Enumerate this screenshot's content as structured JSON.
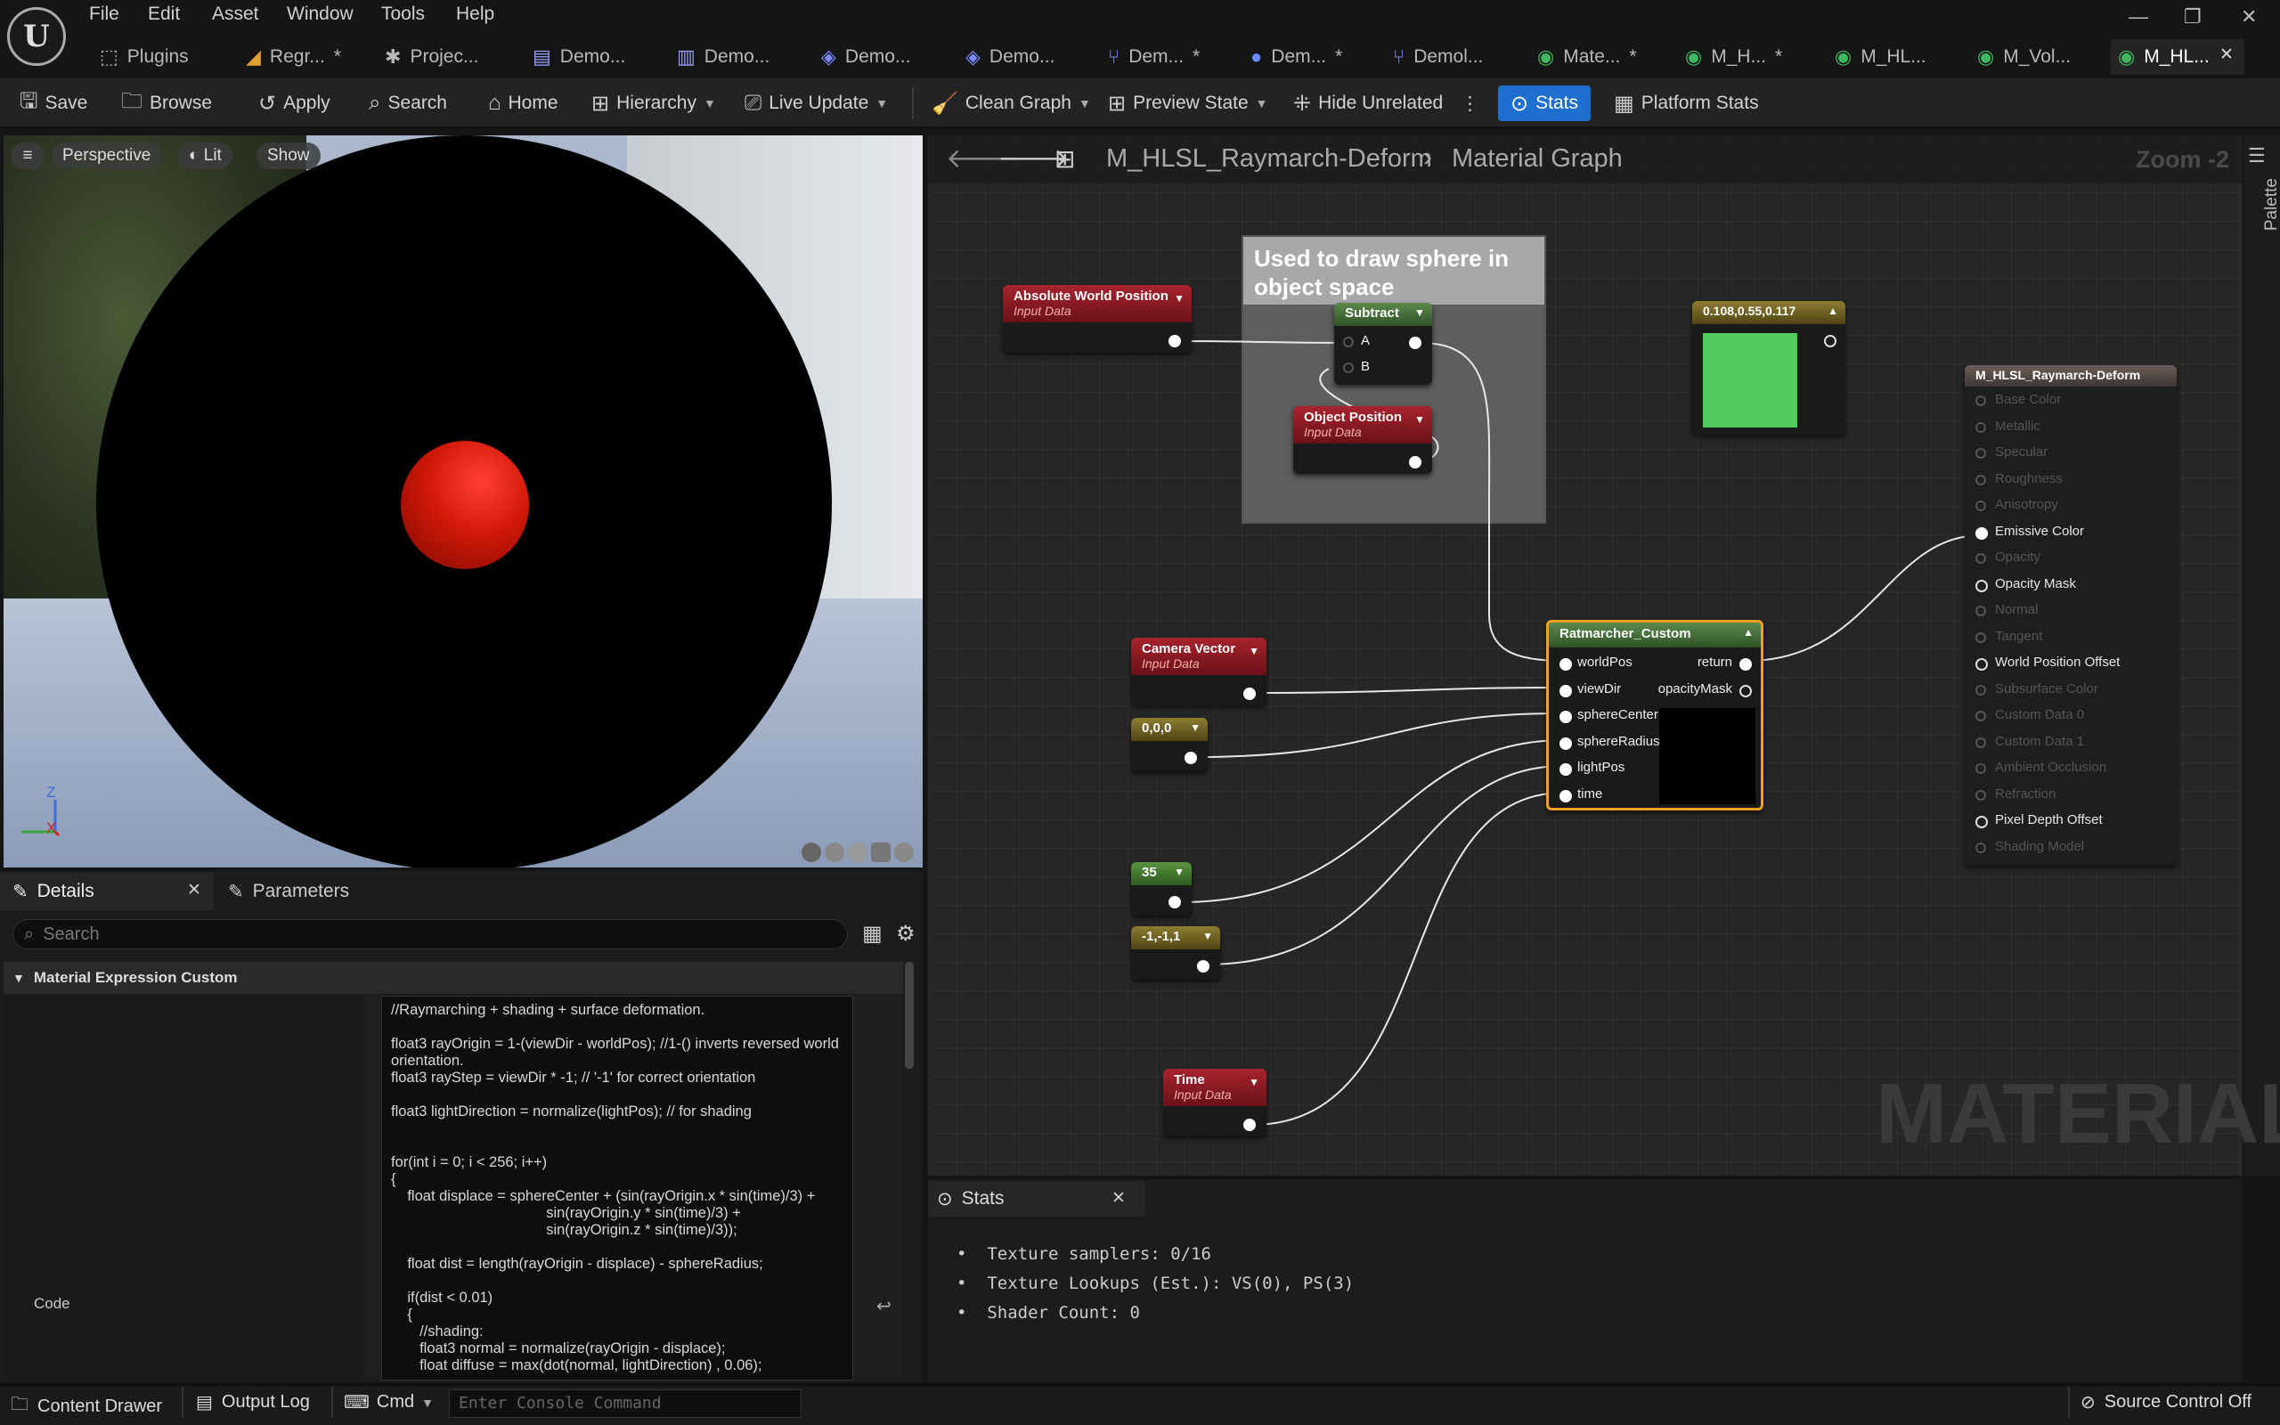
{
  "app": {
    "logo": "U"
  },
  "menu": [
    "File",
    "Edit",
    "Asset",
    "Window",
    "Tools",
    "Help"
  ],
  "tabs": [
    {
      "label": "Plugins",
      "icon": "plugin-icon"
    },
    {
      "label": "Regr...",
      "icon": "chart-icon",
      "dirty": "*"
    },
    {
      "label": "Projec...",
      "icon": "settings-icon"
    },
    {
      "label": "Demo...",
      "icon": "level-icon"
    },
    {
      "label": "Demo...",
      "icon": "blueprint-icon"
    },
    {
      "label": "Demo...",
      "icon": "cube-icon"
    },
    {
      "label": "Demo...",
      "icon": "cube-icon"
    },
    {
      "label": "Dem...",
      "icon": "graph-icon",
      "dirty": "*"
    },
    {
      "label": "Dem...",
      "icon": "material-icon",
      "dirty": "*"
    },
    {
      "label": "Demol...",
      "icon": "graph-icon"
    },
    {
      "label": "Mate...",
      "icon": "material-instance-icon",
      "dirty": "*"
    },
    {
      "label": "M_H...",
      "icon": "material-icon",
      "dirty": "*"
    },
    {
      "label": "M_HL...",
      "icon": "material-icon"
    },
    {
      "label": "M_Vol...",
      "icon": "material-icon"
    },
    {
      "label": "M_HL...",
      "icon": "material-icon",
      "close": "✕"
    }
  ],
  "toolbar": {
    "save": "Save",
    "browse": "Browse",
    "apply": "Apply",
    "search": "Search",
    "home": "Home",
    "hierarchy": "Hierarchy",
    "live_update": "Live Update",
    "clean_graph": "Clean Graph",
    "preview_state": "Preview State",
    "hide_unrelated": "Hide Unrelated",
    "stats": "Stats",
    "platform_stats": "Platform Stats"
  },
  "viewport": {
    "perspective": "Perspective",
    "lit": "Lit",
    "show": "Show",
    "axis_z": "Z",
    "axis_x": "X"
  },
  "details": {
    "tab_details": "Details",
    "tab_parameters": "Parameters",
    "search_placeholder": "Search",
    "category": "Material Expression Custom",
    "code_label": "Code",
    "code": "//Raymarching + shading + surface deformation.\n\nfloat3 rayOrigin = 1-(viewDir - worldPos); //1-() inverts reversed world\norientation.\nfloat3 rayStep = viewDir * -1; // '-1' for correct orientation\n\nfloat3 lightDirection = normalize(lightPos); // for shading\n\n\nfor(int i = 0; i < 256; i++)\n{\n    float displace = sphereCenter + (sin(rayOrigin.x * sin(time)/3) +\n                                      sin(rayOrigin.y * sin(time)/3) +\n                                      sin(rayOrigin.z * sin(time)/3));\n\n    float dist = length(rayOrigin - displace) - sphereRadius;\n\n    if(dist < 0.01)\n    {\n       //shading:\n       float3 normal = normalize(rayOrigin - displace);\n       float diffuse = max(dot(normal, lightDirection) , 0.06);"
  },
  "graph": {
    "asset": "M_HLSL_Raymarch-Deform",
    "crumb": "Material Graph",
    "zoom": "Zoom -2",
    "palette": "Palette",
    "watermark": "MATERIAL",
    "comment": "Used to draw sphere in object space",
    "nodes": {
      "awp": {
        "title": "Absolute World Position",
        "sub": "Input Data"
      },
      "subtract": {
        "title": "Subtract",
        "a": "A",
        "b": "B"
      },
      "objpos": {
        "title": "Object Position",
        "sub": "Input Data"
      },
      "color": {
        "title": "0.108,0.55,0.117",
        "swatch": "#4fcc5c"
      },
      "camvec": {
        "title": "Camera Vector",
        "sub": "Input Data"
      },
      "zero": {
        "title": "0,0,0"
      },
      "radius": {
        "title": "35"
      },
      "light": {
        "title": "-1,-1,1"
      },
      "time": {
        "title": "Time",
        "sub": "Input Data"
      },
      "custom": {
        "title": "Ratmarcher_Custom",
        "inputs": [
          "worldPos",
          "viewDir",
          "sphereCenter",
          "sphereRadius",
          "lightPos",
          "time"
        ],
        "out_return": "return",
        "out_mask": "opacityMask"
      },
      "result": {
        "title": "M_HLSL_Raymarch-Deform",
        "pins": [
          {
            "label": "Base Color",
            "on": false
          },
          {
            "label": "Metallic",
            "on": false
          },
          {
            "label": "Specular",
            "on": false
          },
          {
            "label": "Roughness",
            "on": false
          },
          {
            "label": "Anisotropy",
            "on": false
          },
          {
            "label": "Emissive Color",
            "on": true,
            "connected": true
          },
          {
            "label": "Opacity",
            "on": false
          },
          {
            "label": "Opacity Mask",
            "on": true
          },
          {
            "label": "Normal",
            "on": false
          },
          {
            "label": "Tangent",
            "on": false
          },
          {
            "label": "World Position Offset",
            "on": true
          },
          {
            "label": "Subsurface Color",
            "on": false
          },
          {
            "label": "Custom Data 0",
            "on": false
          },
          {
            "label": "Custom Data 1",
            "on": false
          },
          {
            "label": "Ambient Occlusion",
            "on": false
          },
          {
            "label": "Refraction",
            "on": false
          },
          {
            "label": "Pixel Depth Offset",
            "on": true
          },
          {
            "label": "Shading Model",
            "on": false
          }
        ]
      }
    }
  },
  "stats": {
    "tab": "Stats",
    "lines": [
      "Texture samplers: 0/16",
      "Texture Lookups (Est.): VS(0), PS(3)",
      "Shader Count: 0"
    ]
  },
  "bottom": {
    "content_drawer": "Content Drawer",
    "output_log": "Output Log",
    "cmd": "Cmd",
    "console_placeholder": "Enter Console Command",
    "source_control": "Source Control Off"
  }
}
